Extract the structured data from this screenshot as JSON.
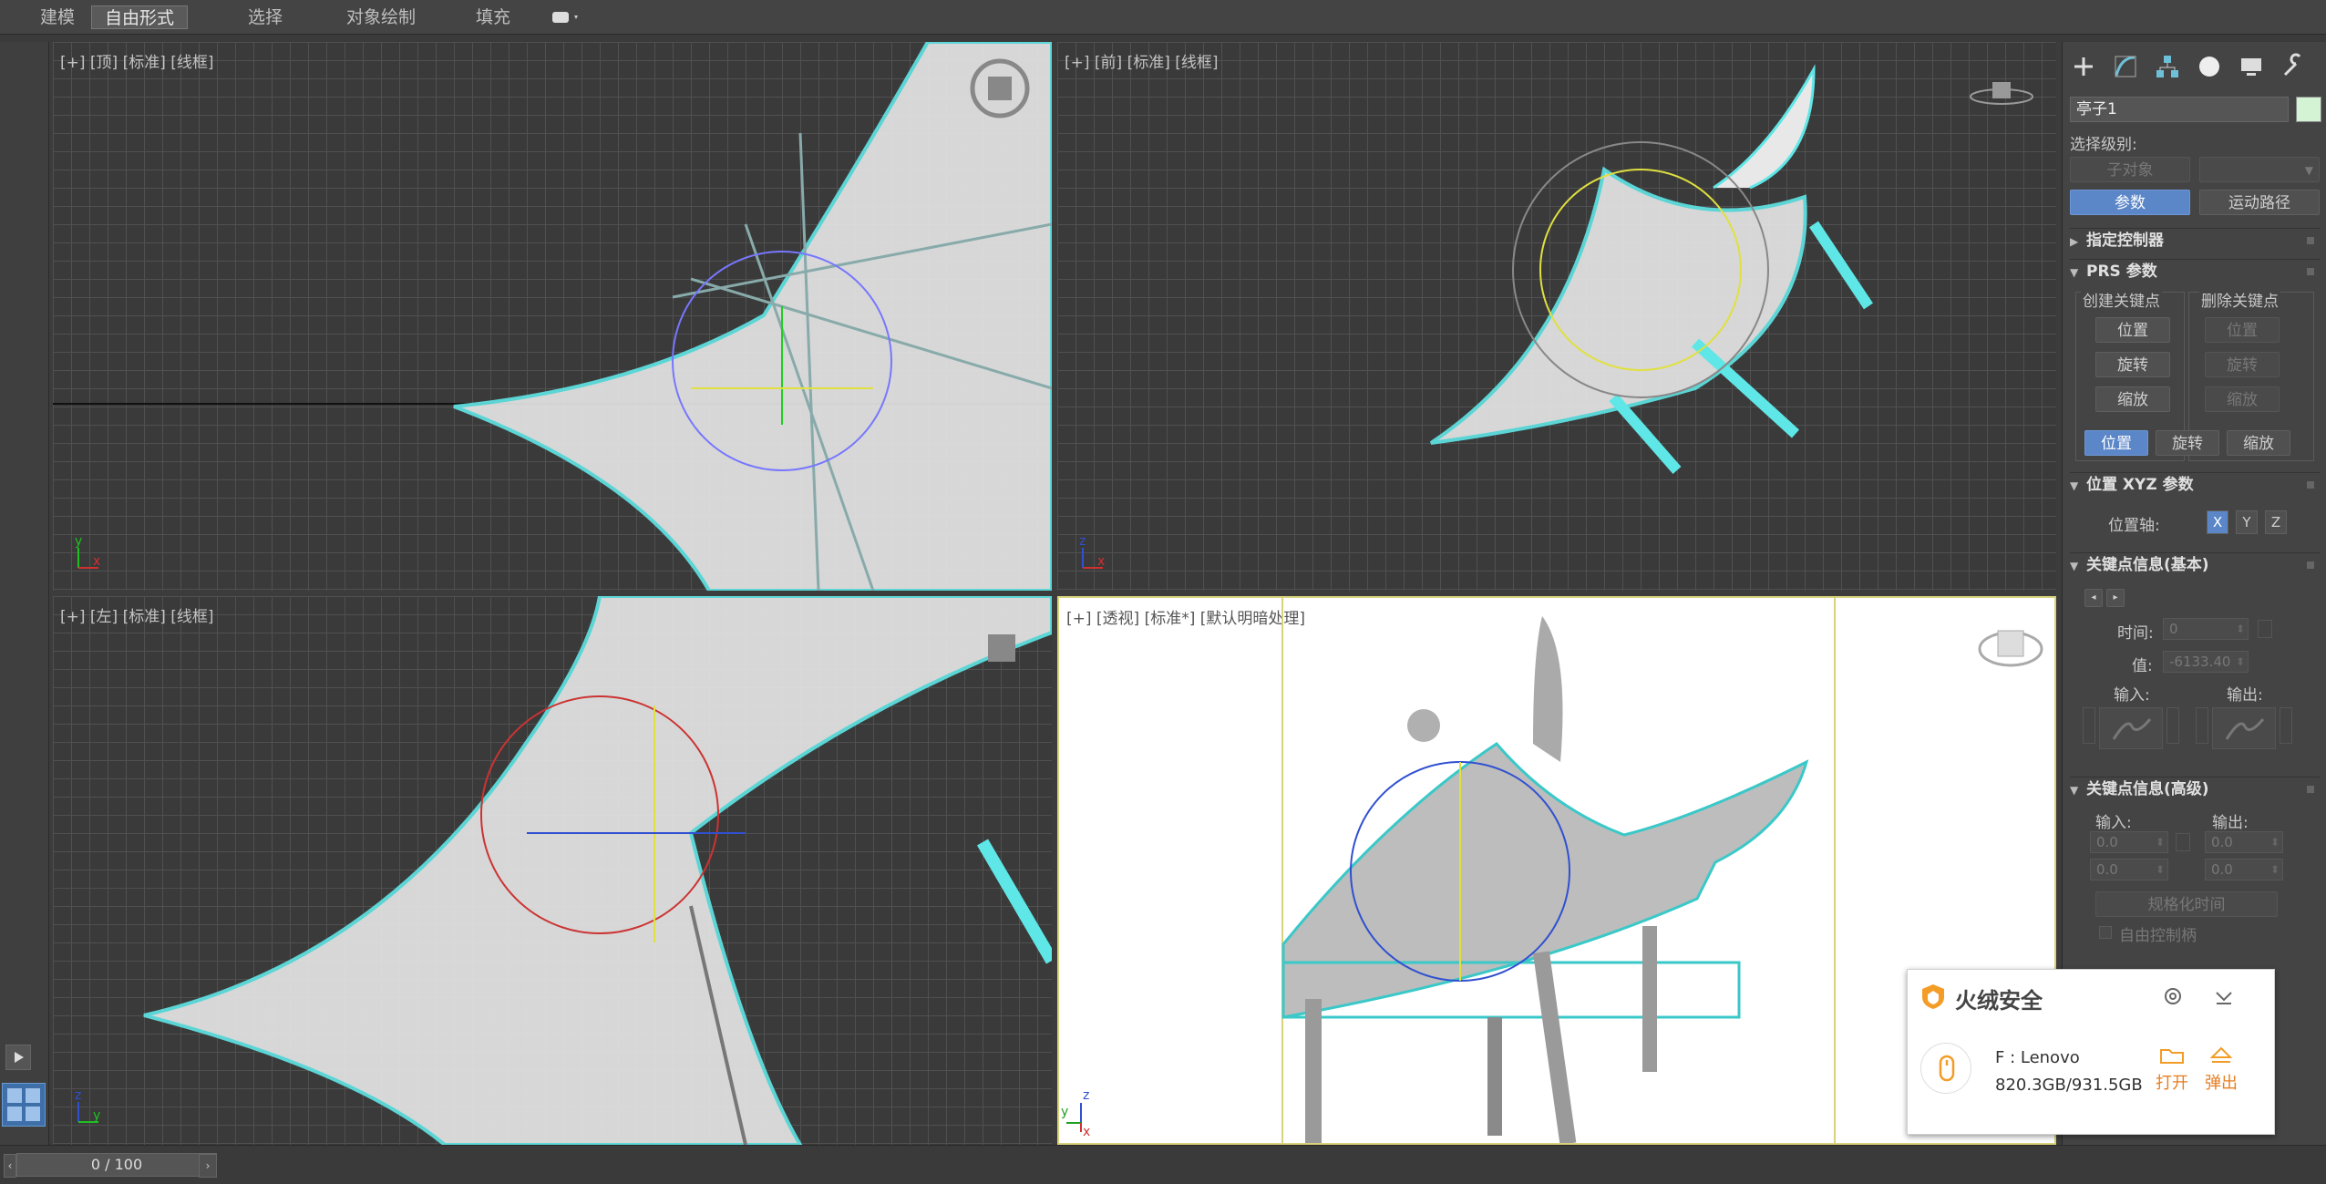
{
  "ribbon": {
    "tabs": [
      "建模",
      "自由形式",
      "选择",
      "对象绘制",
      "填充"
    ],
    "active_tab": "自由形式"
  },
  "viewports": {
    "top": "[+] [顶] [标准] [线框]",
    "front": "[+] [前] [标准] [线框]",
    "left": "[+] [左] [标准] [线框]",
    "perspective": "[+] [透视] [标准*] [默认明暗处理]"
  },
  "axes": {
    "x": "x",
    "y": "y",
    "z": "z"
  },
  "panel": {
    "object_name": "亭子1",
    "object_color": "#d4f3d4",
    "selection_level_label": "选择级别:",
    "sub_object_button": "子对象",
    "params_button": "参数",
    "trajectories_button": "运动路径",
    "assign_controller": "指定控制器",
    "prs_rollout": "PRS 参数",
    "create_key_label": "创建关键点",
    "delete_key_label": "删除关键点",
    "create_keys": [
      "位置",
      "旋转",
      "缩放"
    ],
    "delete_keys": [
      "位置",
      "旋转",
      "缩放"
    ],
    "prs_tabs": [
      "位置",
      "旋转",
      "缩放"
    ],
    "xyz_rollout": "位置 XYZ 参数",
    "position_axis_label": "位置轴:",
    "axis_buttons": [
      "X",
      "Y",
      "Z"
    ],
    "key_info_basic": "关键点信息(基本)",
    "time_label": "时间:",
    "time_value": "0",
    "value_label": "值:",
    "value_value": "-6133.40",
    "in_label": "输入:",
    "out_label": "输出:",
    "key_info_advanced": "关键点信息(高级)",
    "adv_in_label": "输入:",
    "adv_out_label": "输出:",
    "adv_values": [
      "0.0",
      "0.0",
      "0.0",
      "0.0"
    ],
    "normalize_time": "规格化时间",
    "free_handle": "自由控制柄"
  },
  "timeline": {
    "frame": "0 / 100"
  },
  "popup": {
    "title": "火绒安全",
    "drive": "F : Lenovo",
    "size": "820.3GB/931.5GB",
    "open": "打开",
    "eject": "弹出"
  }
}
